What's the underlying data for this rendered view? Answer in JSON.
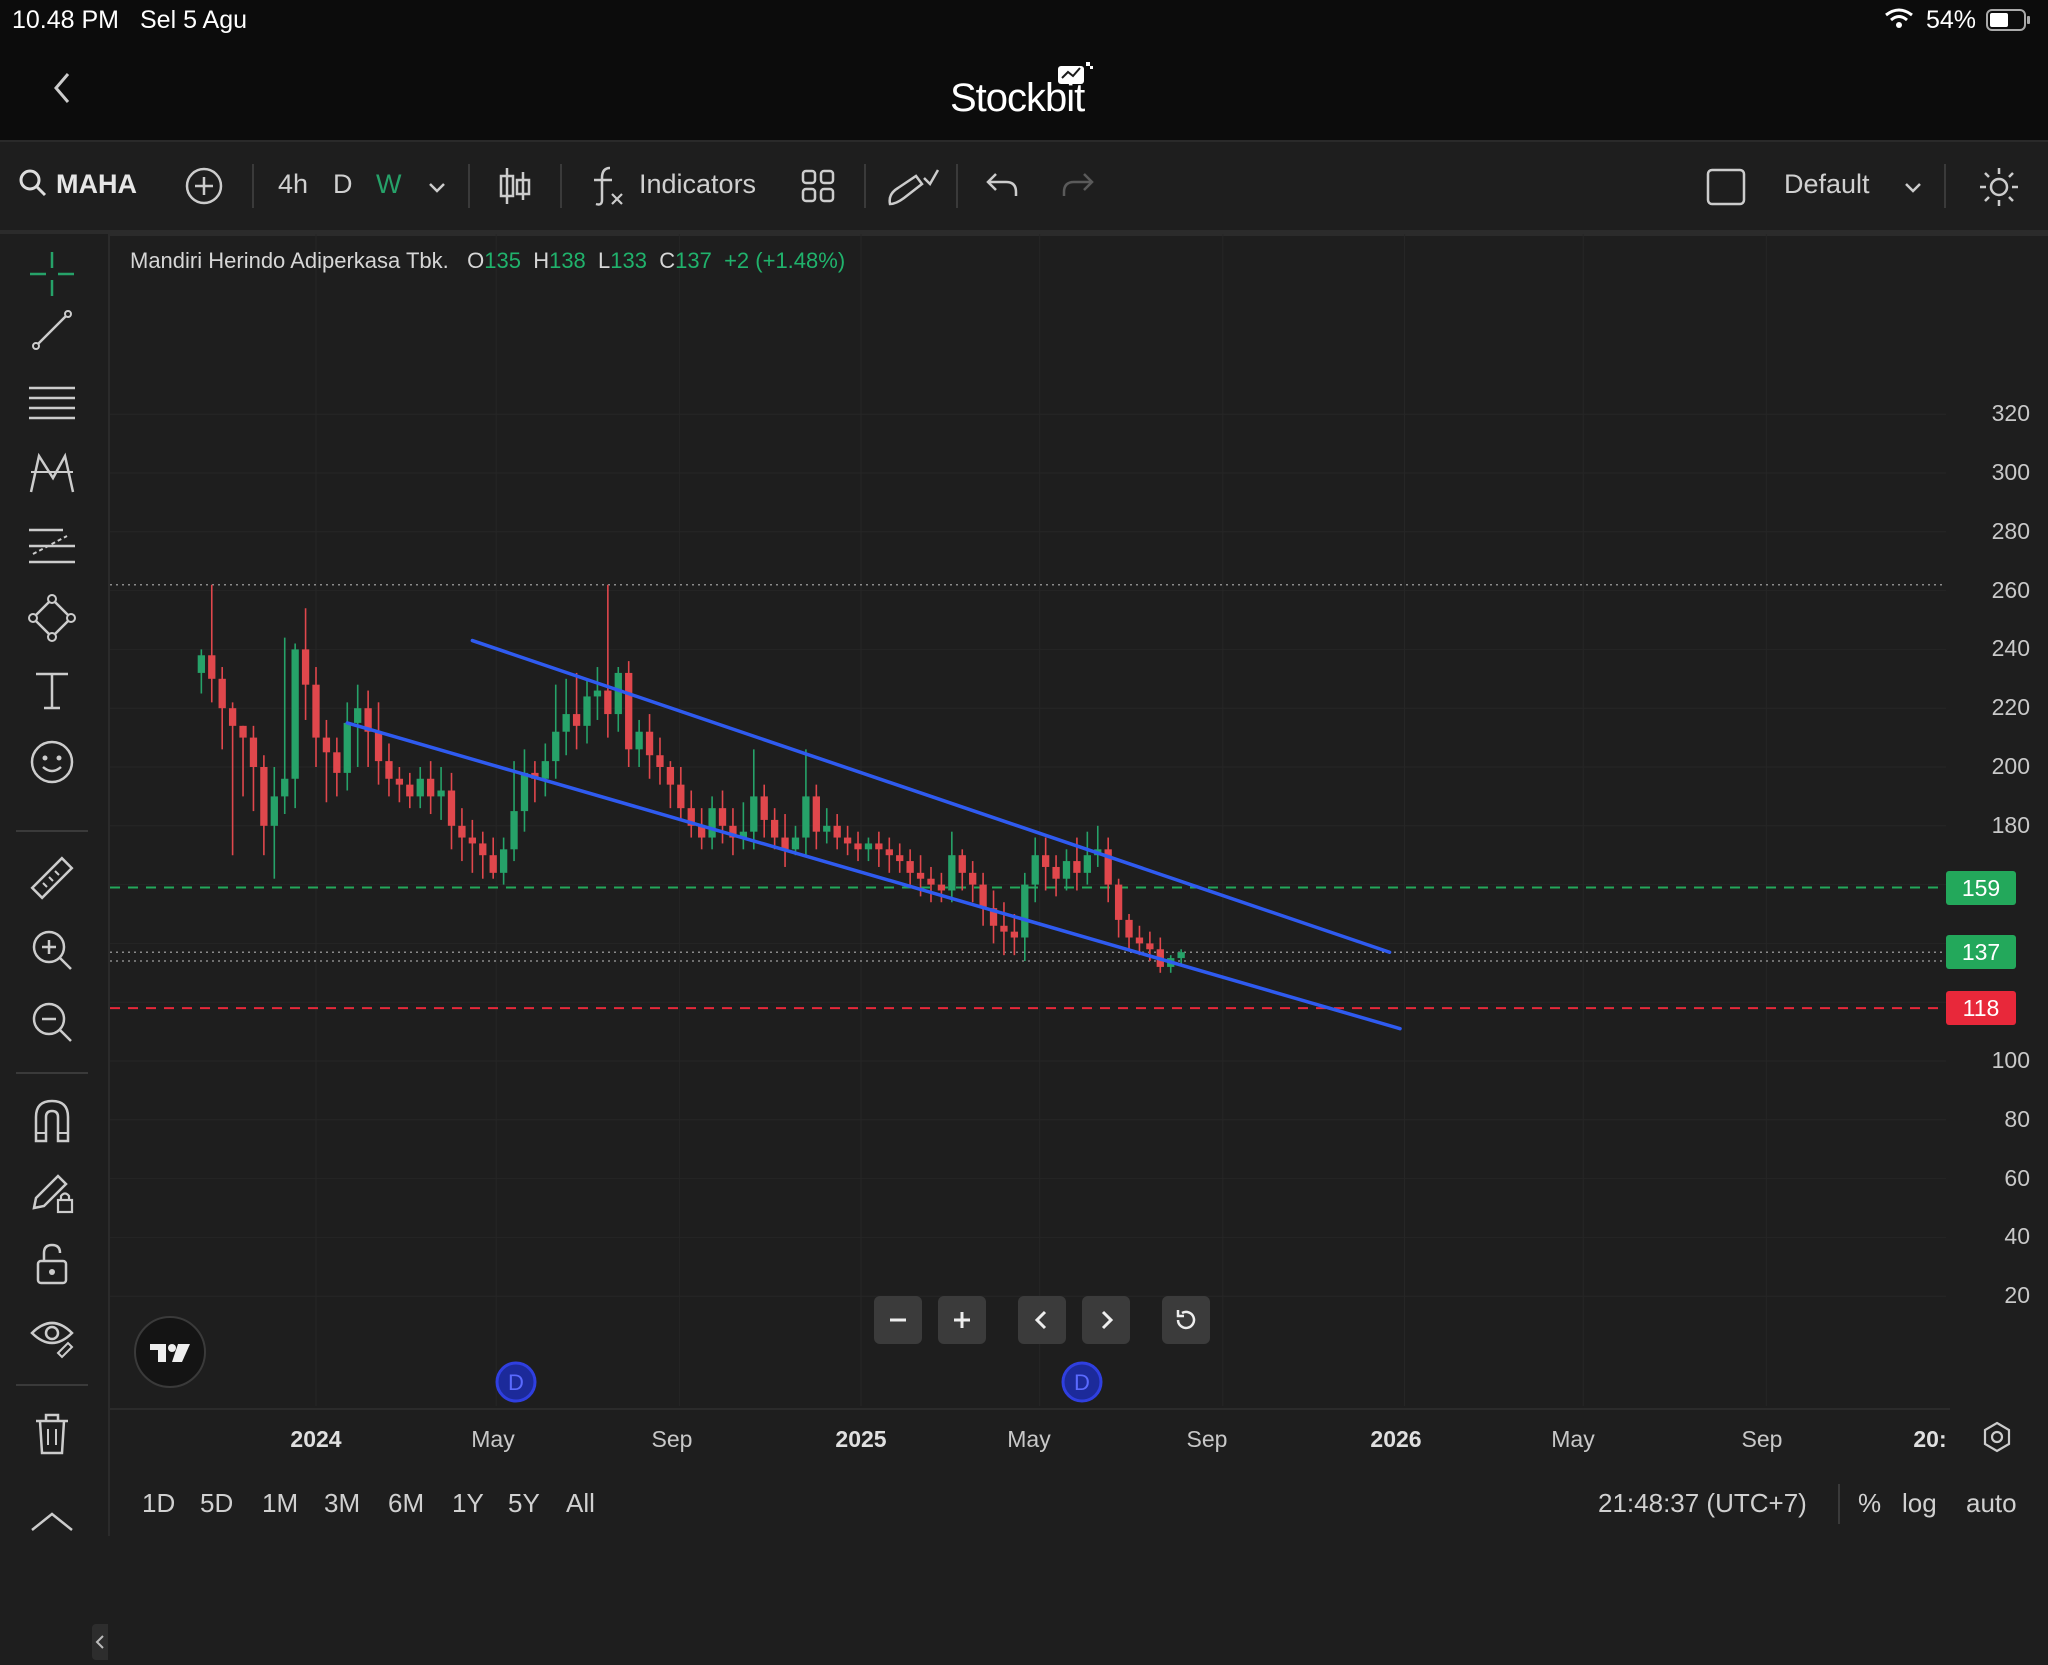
{
  "status_bar": {
    "time": "10.48 PM",
    "date": "Sel 5 Agu",
    "battery": "54%",
    "wifi_icon": "wifi-icon",
    "battery_icon": "battery-icon"
  },
  "app": {
    "title": "Stockbit",
    "back_icon": "chevron-left-icon"
  },
  "toolbar": {
    "symbol": "MAHA",
    "intervals": [
      "4h",
      "D",
      "W"
    ],
    "active_interval": "W",
    "indicators_label": "Indicators",
    "layout_label": "Default"
  },
  "legend": {
    "name": "Mandiri Herindo Adiperkasa Tbk.",
    "o_label": "O",
    "o": "135",
    "h_label": "H",
    "h": "138",
    "l_label": "L",
    "l": "133",
    "c_label": "C",
    "c": "137",
    "change": "+2 (+1.48%)"
  },
  "price_axis": [
    "320",
    "300",
    "280",
    "260",
    "240",
    "220",
    "200",
    "180",
    "100",
    "80",
    "60",
    "40",
    "20"
  ],
  "price_tags": {
    "resistance": "159",
    "last": "137",
    "support": "118"
  },
  "time_axis": [
    "2024",
    "May",
    "Sep",
    "2025",
    "May",
    "Sep",
    "2026",
    "May",
    "Sep",
    "20:"
  ],
  "ranges": [
    "1D",
    "5D",
    "1M",
    "3M",
    "6M",
    "1Y",
    "5Y",
    "All"
  ],
  "bottom_right": {
    "clock": "21:48:37 (UTC+7)",
    "percent": "%",
    "log": "log",
    "auto": "auto"
  },
  "colors": {
    "up": "#26a269",
    "down": "#e0474c",
    "trend": "#2f5bf0",
    "tag_green": "#23a85b",
    "tag_red": "#e8283a"
  },
  "chart_data": {
    "type": "candlestick",
    "symbol": "MAHA",
    "interval": "W",
    "ylim": [
      0,
      330
    ],
    "last": {
      "o": 135,
      "h": 138,
      "l": 133,
      "c": 137
    },
    "horizontal_lines": [
      {
        "price": 262,
        "style": "dotted"
      },
      {
        "price": 159,
        "style": "dashed",
        "color": "#23a85b"
      },
      {
        "price": 137,
        "style": "dotted"
      },
      {
        "price": 134,
        "style": "dotted"
      },
      {
        "price": 118,
        "style": "dashed",
        "color": "#e8283a"
      }
    ],
    "trendlines": [
      {
        "from": [
          "2024-04-15",
          243
        ],
        "to": [
          "2025-12-22",
          137
        ]
      },
      {
        "from": [
          "2024-01-22",
          215
        ],
        "to": [
          "2025-12-29",
          111
        ]
      }
    ],
    "candles": [
      [
        232,
        238,
        225,
        240
      ],
      [
        238,
        230,
        222,
        262
      ],
      [
        230,
        220,
        206,
        234
      ],
      [
        220,
        214,
        170,
        222
      ],
      [
        214,
        210,
        190,
        214
      ],
      [
        210,
        200,
        185,
        214
      ],
      [
        200,
        180,
        170,
        204
      ],
      [
        180,
        190,
        162,
        200
      ],
      [
        190,
        196,
        184,
        244
      ],
      [
        196,
        240,
        186,
        242
      ],
      [
        240,
        228,
        216,
        254
      ],
      [
        228,
        210,
        200,
        234
      ],
      [
        210,
        205,
        188,
        216
      ],
      [
        205,
        198,
        190,
        210
      ],
      [
        198,
        215,
        192,
        222
      ],
      [
        215,
        220,
        200,
        228
      ],
      [
        220,
        212,
        200,
        226
      ],
      [
        212,
        202,
        194,
        222
      ],
      [
        202,
        196,
        190,
        208
      ],
      [
        196,
        194,
        188,
        200
      ],
      [
        194,
        190,
        186,
        198
      ],
      [
        190,
        196,
        186,
        200
      ],
      [
        196,
        190,
        184,
        202
      ],
      [
        190,
        192,
        182,
        200
      ],
      [
        192,
        180,
        172,
        198
      ],
      [
        180,
        176,
        168,
        186
      ],
      [
        176,
        174,
        164,
        182
      ],
      [
        174,
        170,
        162,
        178
      ],
      [
        170,
        164,
        162,
        176
      ],
      [
        164,
        172,
        160,
        176
      ],
      [
        172,
        185,
        168,
        202
      ],
      [
        185,
        198,
        178,
        206
      ],
      [
        198,
        196,
        188,
        202
      ],
      [
        196,
        202,
        190,
        208
      ],
      [
        202,
        212,
        196,
        228
      ],
      [
        212,
        218,
        204,
        230
      ],
      [
        218,
        214,
        206,
        232
      ],
      [
        214,
        224,
        208,
        230
      ],
      [
        224,
        226,
        216,
        234
      ],
      [
        226,
        218,
        210,
        262
      ],
      [
        218,
        232,
        212,
        234
      ],
      [
        232,
        206,
        200,
        236
      ],
      [
        206,
        212,
        200,
        216
      ],
      [
        212,
        204,
        196,
        218
      ],
      [
        204,
        200,
        194,
        210
      ],
      [
        200,
        194,
        186,
        202
      ],
      [
        194,
        186,
        182,
        200
      ],
      [
        186,
        180,
        176,
        192
      ],
      [
        180,
        176,
        172,
        186
      ],
      [
        176,
        186,
        172,
        190
      ],
      [
        186,
        180,
        174,
        192
      ],
      [
        180,
        176,
        170,
        186
      ],
      [
        176,
        178,
        172,
        188
      ],
      [
        178,
        190,
        172,
        206
      ],
      [
        190,
        182,
        176,
        194
      ],
      [
        182,
        176,
        172,
        186
      ],
      [
        176,
        172,
        166,
        184
      ],
      [
        172,
        176,
        170,
        180
      ],
      [
        176,
        190,
        170,
        206
      ],
      [
        190,
        178,
        172,
        194
      ],
      [
        178,
        180,
        174,
        186
      ],
      [
        180,
        176,
        172,
        184
      ],
      [
        176,
        174,
        170,
        180
      ],
      [
        174,
        172,
        168,
        178
      ],
      [
        172,
        174,
        168,
        176
      ],
      [
        174,
        172,
        166,
        178
      ],
      [
        172,
        170,
        164,
        176
      ],
      [
        170,
        168,
        164,
        174
      ],
      [
        168,
        164,
        160,
        172
      ],
      [
        164,
        162,
        156,
        170
      ],
      [
        162,
        160,
        154,
        166
      ],
      [
        160,
        158,
        154,
        164
      ],
      [
        158,
        170,
        154,
        178
      ],
      [
        170,
        164,
        158,
        172
      ],
      [
        164,
        160,
        154,
        168
      ],
      [
        160,
        152,
        146,
        164
      ],
      [
        152,
        146,
        140,
        158
      ],
      [
        146,
        144,
        136,
        154
      ],
      [
        144,
        142,
        136,
        150
      ],
      [
        142,
        160,
        134,
        164
      ],
      [
        160,
        170,
        154,
        176
      ],
      [
        170,
        166,
        158,
        176
      ],
      [
        166,
        162,
        156,
        170
      ],
      [
        162,
        168,
        158,
        172
      ],
      [
        168,
        164,
        158,
        176
      ],
      [
        164,
        170,
        160,
        178
      ],
      [
        170,
        172,
        166,
        180
      ],
      [
        172,
        160,
        154,
        176
      ],
      [
        160,
        148,
        142,
        162
      ],
      [
        148,
        142,
        138,
        150
      ],
      [
        142,
        140,
        136,
        146
      ],
      [
        140,
        138,
        134,
        144
      ],
      [
        138,
        132,
        130,
        142
      ],
      [
        132,
        135,
        130,
        136
      ],
      [
        135,
        137,
        133,
        138
      ]
    ]
  }
}
